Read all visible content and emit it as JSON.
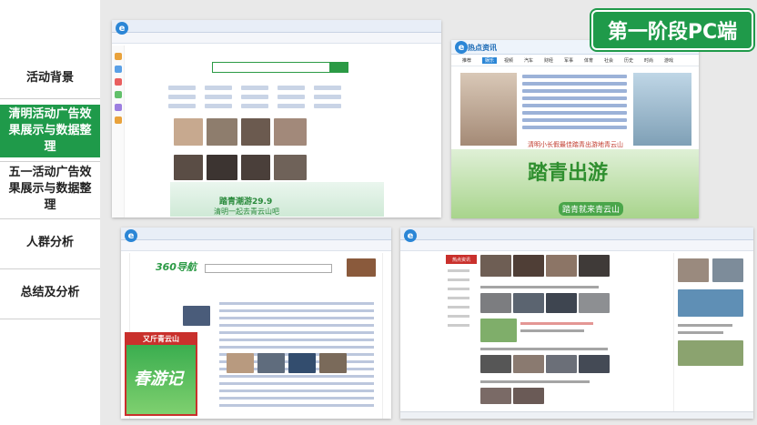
{
  "sidebar": {
    "items": [
      {
        "label": "活动背景",
        "active": false
      },
      {
        "label": "清明活动广告效果展示与数据整理",
        "active": true
      },
      {
        "label": "五一活动广告效果展示与数据整理",
        "active": false
      },
      {
        "label": "人群分析",
        "active": false
      },
      {
        "label": "总结及分析",
        "active": false
      }
    ]
  },
  "title_badge": "第一阶段PC端",
  "shot1": {
    "banner_text1": "踏青潮游29.9",
    "banner_text2": "清明一起去青云山吧"
  },
  "shot2": {
    "header": "热点资讯",
    "tabs": [
      "推荐",
      "娱乐",
      "视频",
      "汽车",
      "财经",
      "军事",
      "体育",
      "社会",
      "历史",
      "时尚",
      "游戏"
    ],
    "active_tab": "娱乐",
    "sub": "清明小长假最佳踏青出游地青云山",
    "banner_text1": "踏青出游",
    "banner_text2": "踏青就来青云山"
  },
  "shot3": {
    "logo": "360导航",
    "promo_head": "又斤青云山",
    "promo_text": "春游记"
  },
  "shot4": {
    "brand": "热点资讯"
  },
  "colors": {
    "accent_green": "#1f9a4a",
    "banner_green": "#2b9a45",
    "red": "#c9302c",
    "link_blue": "#2b86d6"
  }
}
